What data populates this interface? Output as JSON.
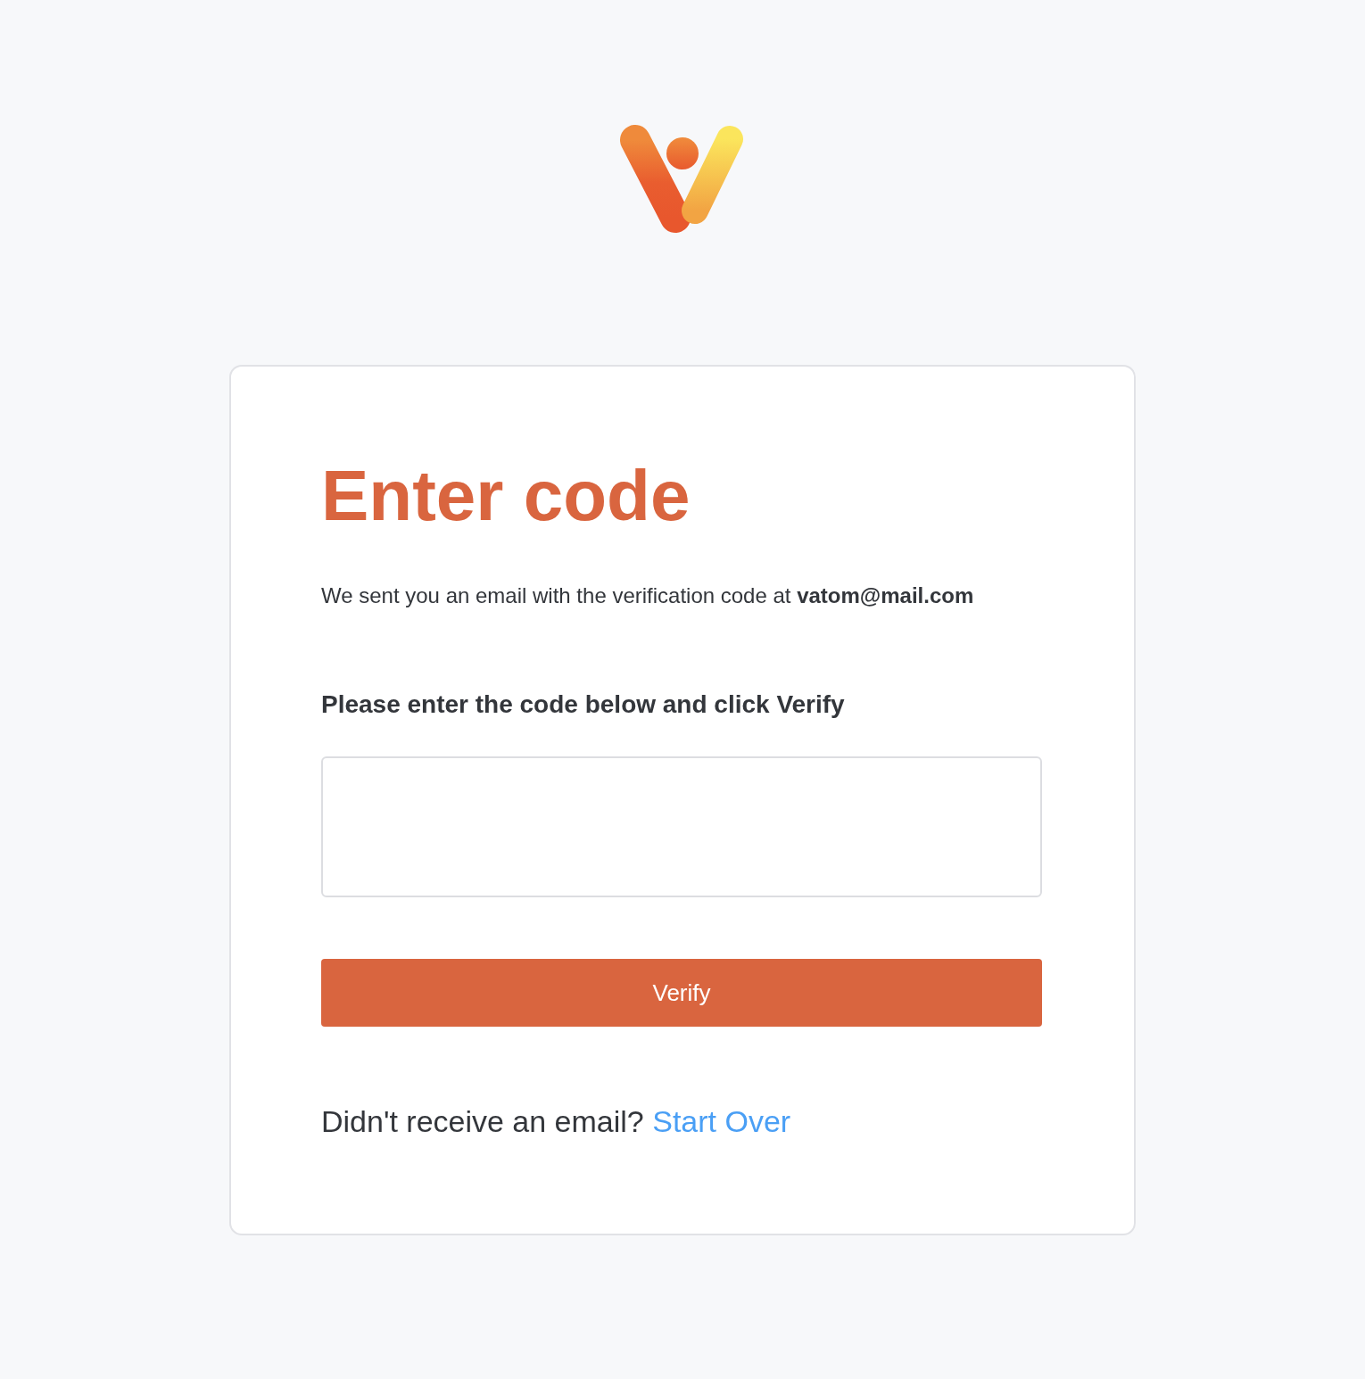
{
  "card": {
    "title": "Enter code",
    "message": "We sent you an email with the verification code at **vatom@mail.com**",
    "code_field": {
      "label": "Please enter the code below and click Verify"
    },
    "verify_button": {
      "label": "Verify"
    },
    "footer": {
      "prompt": "Didn't receive an email?",
      "link": "Start Over"
    }
  }
}
